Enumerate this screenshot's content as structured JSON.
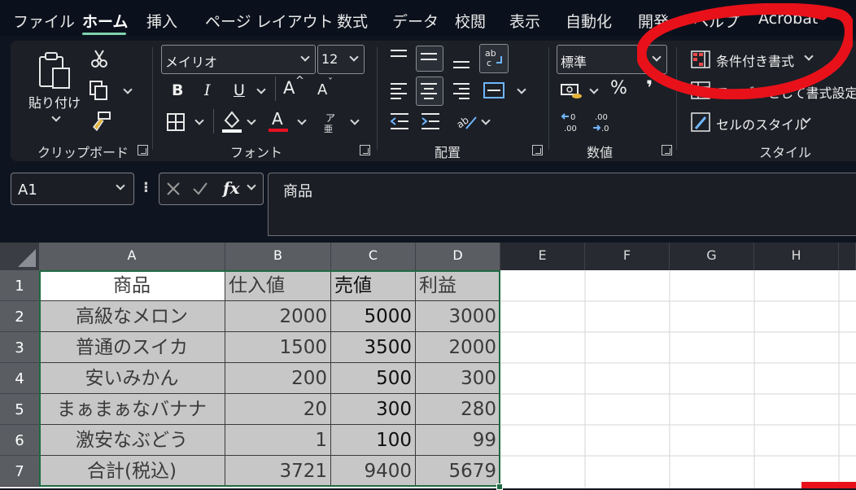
{
  "menu": {
    "items": [
      "ファイル",
      "ホーム",
      "挿入",
      "ページ レイアウト",
      "数式",
      "データ",
      "校閲",
      "表示",
      "自動化",
      "開発",
      "ヘルプ",
      "Acrobat"
    ],
    "active": "ホーム"
  },
  "ribbon": {
    "clipboard": {
      "paste_label": "貼り付け",
      "group_label": "クリップボード"
    },
    "font": {
      "font_name": "メイリオ",
      "font_size": "12",
      "bold": "B",
      "italic": "I",
      "underline": "U",
      "grow": "A",
      "shrink": "A",
      "color_letter": "A",
      "phonetic": "ア",
      "group_label": "フォント"
    },
    "alignment": {
      "group_label": "配置"
    },
    "number": {
      "format": "標準",
      "percent": "%",
      "comma": "❜",
      "group_label": "数値"
    },
    "styles": {
      "conditional": "条件付き書式",
      "as_table": "テーブルとして書式設定",
      "cell_styles": "セルのスタイル",
      "group_label": "スタイル"
    }
  },
  "formula_bar": {
    "name_box": "A1",
    "content": "商品",
    "fx": "fx"
  },
  "columns": [
    "A",
    "B",
    "C",
    "D",
    "E",
    "F",
    "G",
    "H"
  ],
  "rows": [
    "1",
    "2",
    "3",
    "4",
    "5",
    "6",
    "7"
  ],
  "table": [
    [
      "商品",
      "仕入値",
      "売値",
      "利益"
    ],
    [
      "高級なメロン",
      "2000",
      "5000",
      "3000"
    ],
    [
      "普通のスイカ",
      "1500",
      "3500",
      "2000"
    ],
    [
      "安いみかん",
      "200",
      "500",
      "300"
    ],
    [
      "まぁまぁなバナナ",
      "20",
      "300",
      "280"
    ],
    [
      "激安なぶどう",
      "1",
      "100",
      "99"
    ],
    [
      "合計(税込)",
      "3721",
      "9400",
      "5679"
    ]
  ],
  "colors": {
    "accent": "#7fd3b0",
    "selection": "#1e6b43",
    "annotation": "#e8111a",
    "font_color_bar": "#e81123"
  }
}
